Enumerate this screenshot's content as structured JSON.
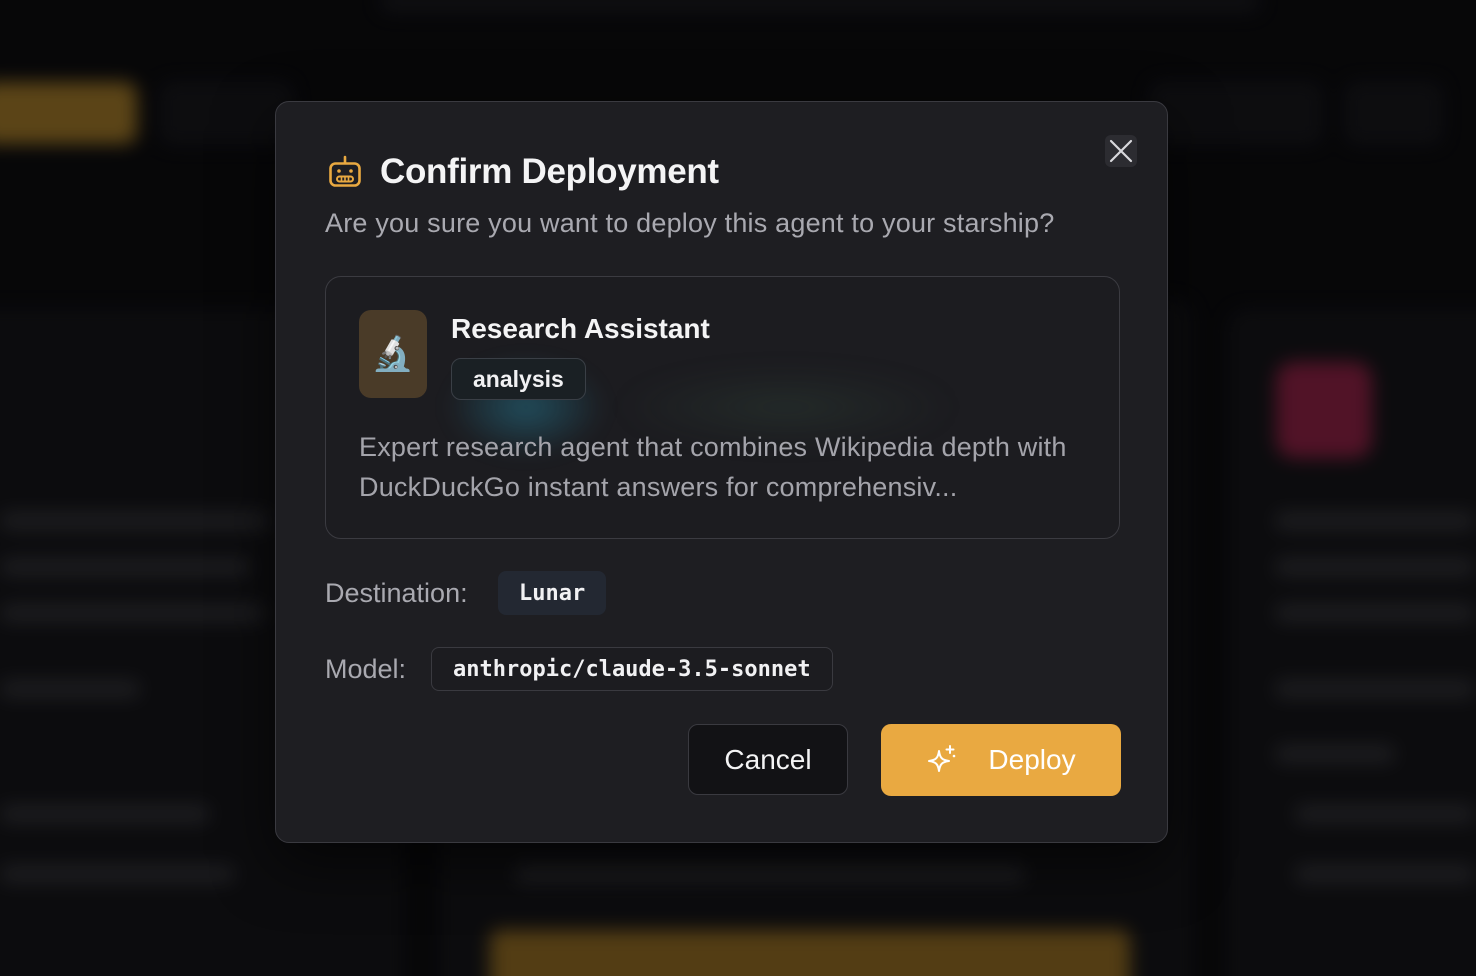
{
  "dialog": {
    "title": "Confirm Deployment",
    "subtitle": "Are you sure you want to deploy this agent to your starship?",
    "title_icon": "robot-icon",
    "close_icon": "close-icon"
  },
  "agent": {
    "avatar_emoji": "🔬",
    "name": "Research Assistant",
    "tag": "analysis",
    "description": "Expert research agent that combines Wikipedia depth with DuckDuckGo instant answers for comprehensiv..."
  },
  "details": {
    "destination_label": "Destination:",
    "destination_value": "Lunar",
    "model_label": "Model:",
    "model_value": "anthropic/claude-3.5-sonnet"
  },
  "actions": {
    "cancel_label": "Cancel",
    "deploy_label": "Deploy",
    "deploy_icon": "sparkle-icon"
  },
  "colors": {
    "accent": "#e9a941",
    "modal_bg": "#1f1f23",
    "page_bg": "#0d0d10"
  }
}
